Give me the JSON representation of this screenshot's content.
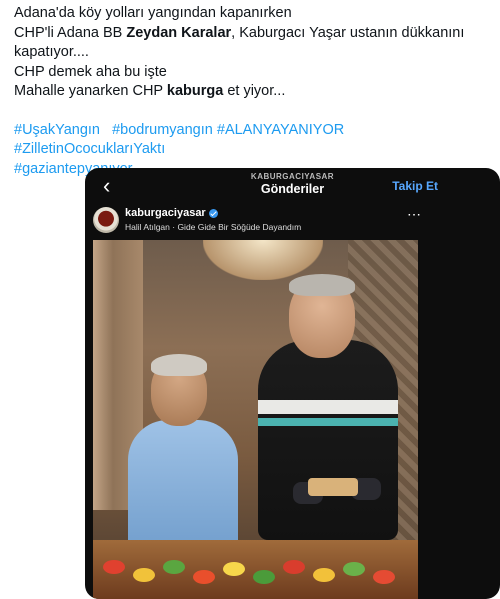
{
  "tweet": {
    "line1": "Adana'da köy yolları yangından kapanırken",
    "line2_pre": "CHP'li Adana BB ",
    "line2_bold": "Zeydan Karalar",
    "line2_post": ", Kaburgacı Yaşar ustanın dükkanını",
    "line3": "kapatıyor....",
    "line4": "CHP demek aha bu işte",
    "line5_pre": "Mahalle yanarken CHP ",
    "line5_bold": "kaburga",
    "line5_post": " et yiyor...",
    "hashtags": [
      "#UşakYangın",
      "#bodrumyangın",
      "#ALANYAYANIYOR",
      "#ZilletinOcocuklarıYaktı",
      "#gaziantepyanıyor"
    ]
  },
  "instagram": {
    "account_top": "KABURGACIYASAR",
    "title": "Gönderiler",
    "follow_label": "Takip Et",
    "username": "kaburgaciyasar",
    "song": "Halil Atılgan · Gide Gide Bir Söğüde Dayandım",
    "back_icon": "chevron-left-icon",
    "more_icon": "more-horizontal-icon",
    "verified_color": "#3897f0"
  },
  "colors": {
    "hashtag": "#1d9bf0",
    "text": "#0f1419"
  }
}
